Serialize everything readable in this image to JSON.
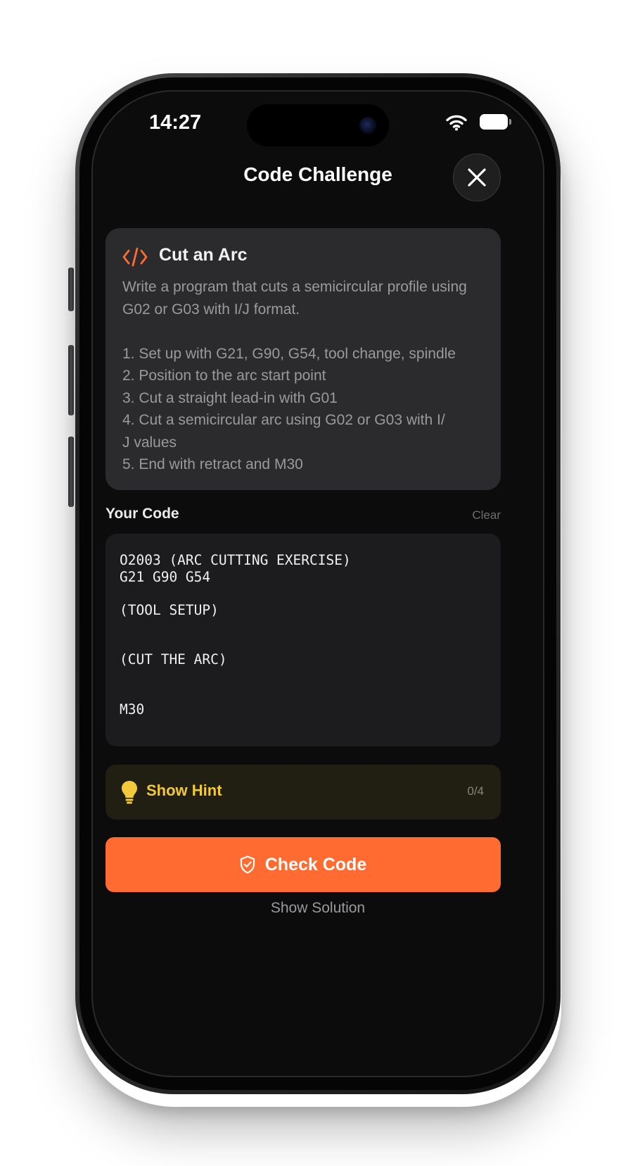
{
  "status_bar": {
    "time": "14:27"
  },
  "header": {
    "title": "Code Challenge"
  },
  "challenge": {
    "title": "Cut an Arc",
    "description": "Write a program that cuts a semicircular profile using G02 or G03 with I/J format.\n\n1. Set up with G21, G90, G54, tool change, spindle\n2. Position to the arc start point\n3. Cut a straight lead-in with G01\n4. Cut a semicircular arc using G02 or G03 with I/\nJ values\n5. End with retract and M30"
  },
  "editor": {
    "label": "Your Code",
    "clear_label": "Clear",
    "code": "O2003 (ARC CUTTING EXERCISE)\nG21 G90 G54\n\n(TOOL SETUP)\n\n\n(CUT THE ARC)\n\n\nM30"
  },
  "hint": {
    "label": "Show Hint",
    "count": "0/4"
  },
  "actions": {
    "check_label": "Check Code",
    "solution_label": "Show Solution"
  },
  "colors": {
    "accent": "#ff6b30",
    "hint_text": "#f2c93a",
    "background": "#0c0c0c",
    "card": "#2b2b2d"
  },
  "icons": {
    "card": "code-brackets-icon",
    "close": "close-icon",
    "hint": "lightbulb-icon",
    "check": "shield-check-icon"
  }
}
